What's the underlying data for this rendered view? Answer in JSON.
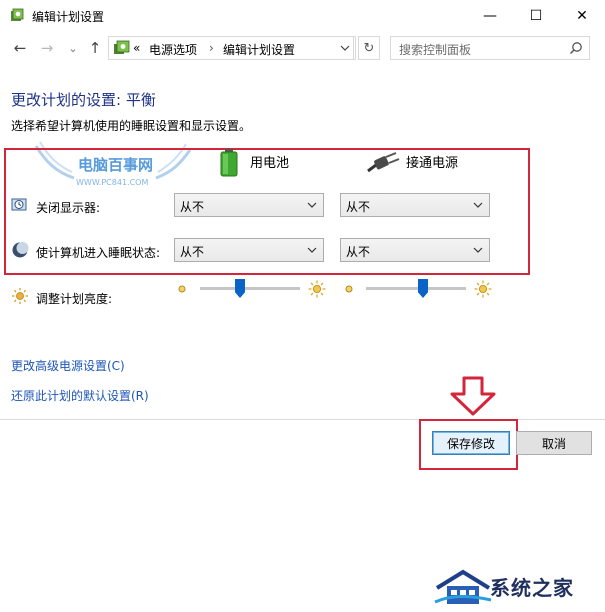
{
  "window": {
    "title": "编辑计划设置",
    "minimize": "—",
    "maximize": "☐",
    "close": "✕"
  },
  "nav": {
    "back_icon": "←",
    "forward_icon": "→",
    "dropdown_icon": "⌄",
    "up_icon": "↑",
    "breadcrumb_sep_start": "«",
    "crumbs": [
      "电源选项",
      "编辑计划设置"
    ],
    "crumb_sep": "›",
    "refresh_icon": "↻",
    "search_placeholder": "搜索控制面板"
  },
  "main": {
    "heading": "更改计划的设置: 平衡",
    "subtitle": "选择希望计算机使用的睡眠设置和显示设置。",
    "col_battery": "用电池",
    "col_plugged": "接通电源",
    "rows": [
      {
        "label": "关闭显示器:",
        "battery": "从不",
        "plugged": "从不"
      },
      {
        "label": "使计算机进入睡眠状态:",
        "battery": "从不",
        "plugged": "从不"
      }
    ],
    "brightness_label": "调整计划亮度:",
    "brightness_battery": 0.4,
    "brightness_plugged": 0.57,
    "link_advanced": "更改高级电源设置(C)",
    "link_restore": "还原此计划的默认设置(R)"
  },
  "buttons": {
    "save": "保存修改",
    "cancel": "取消"
  },
  "watermarks": {
    "top_site": "电脑百事网",
    "top_url": "WWW.PC841.COM",
    "bottom_site": "系统之家"
  },
  "colors": {
    "accent": "#1e3287",
    "link": "#1e56b7",
    "highlight_red": "#d3263a",
    "slider_thumb": "#0a64c8"
  }
}
